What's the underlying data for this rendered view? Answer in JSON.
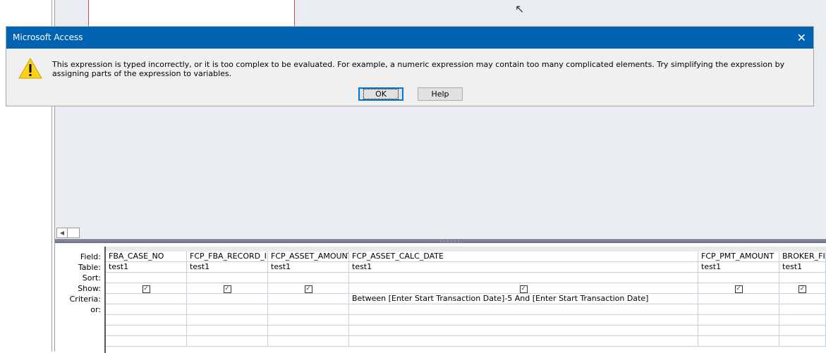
{
  "dialog": {
    "title": "Microsoft Access",
    "close_icon": "close-icon",
    "icon": "warning-icon",
    "message": "This expression is typed incorrectly, or it is too complex to be evaluated. For example, a numeric expression may contain too many complicated elements. Try simplifying the expression by assigning parts of the expression to variables.",
    "ok_label": "OK",
    "help_label": "Help"
  },
  "grid": {
    "row_labels": [
      "Field:",
      "Table:",
      "Sort:",
      "Show:",
      "Criteria:",
      "or:"
    ],
    "columns": [
      {
        "field": "FBA_CASE_NO",
        "table": "test1",
        "sort": "",
        "show": true,
        "criteria": ""
      },
      {
        "field": "FCP_FBA_RECORD_ID",
        "table": "test1",
        "sort": "",
        "show": true,
        "criteria": ""
      },
      {
        "field": "FCP_ASSET_AMOUNT",
        "table": "test1",
        "sort": "",
        "show": true,
        "criteria": ""
      },
      {
        "field": "FCP_ASSET_CALC_DATE",
        "table": "test1",
        "sort": "",
        "show": true,
        "criteria": "Between [Enter Start Transaction Date]-5 And [Enter Start Transaction Date]"
      },
      {
        "field": "FCP_PMT_AMOUNT",
        "table": "test1",
        "sort": "",
        "show": true,
        "criteria": ""
      },
      {
        "field": "BROKER_FIR",
        "table": "test1",
        "sort": "",
        "show": true,
        "criteria": ""
      }
    ]
  },
  "colors": {
    "titlebar": "#0063b1",
    "canvas": "#e9ecf0"
  }
}
